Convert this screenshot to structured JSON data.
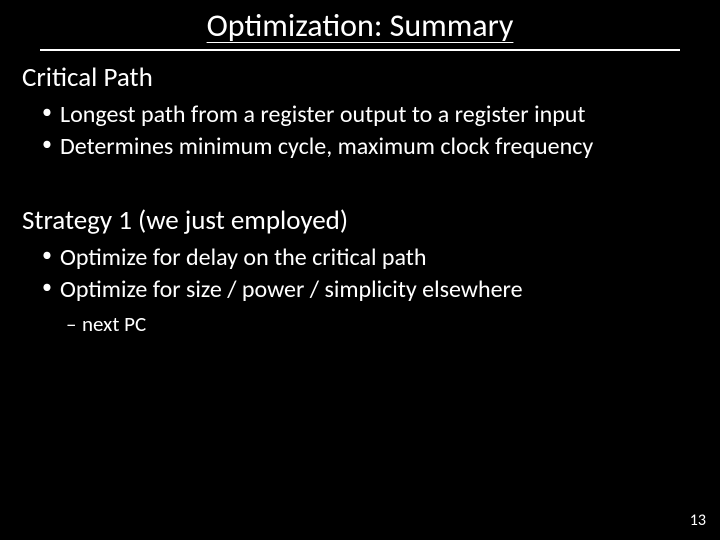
{
  "title": "Optimization: Summary",
  "sections": [
    {
      "heading": "Critical Path",
      "bullets": [
        "Longest path from a register output to a register input",
        "Determines minimum cycle, maximum clock frequency"
      ],
      "sub": []
    },
    {
      "heading": "Strategy 1 (we just employed)",
      "bullets": [
        "Optimize for delay on the critical path",
        "Optimize for size / power / simplicity elsewhere"
      ],
      "sub": [
        "next PC"
      ]
    }
  ],
  "page_number": "13"
}
